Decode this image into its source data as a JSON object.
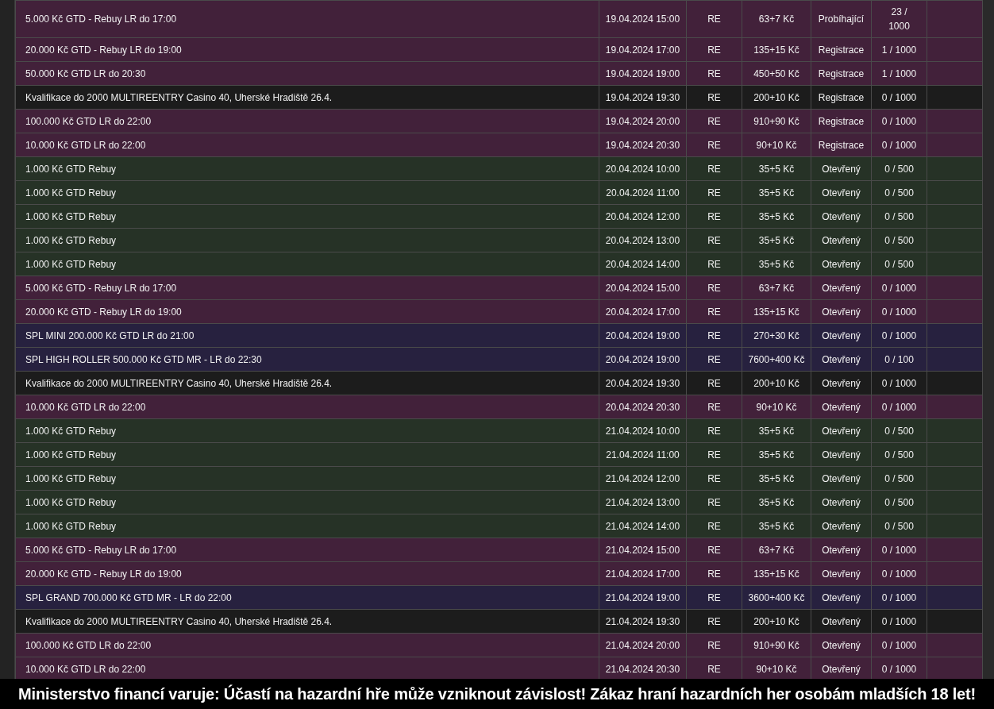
{
  "table": {
    "rows": [
      {
        "name": "5.000 Kč GTD - Rebuy LR do 17:00",
        "start": "19.04.2024 15:00",
        "type": "RE",
        "buyin": "63+7 Kč",
        "status": "Probíhající",
        "players": "23 / 1000",
        "color": "#42213a"
      },
      {
        "name": "20.000 Kč GTD - Rebuy LR do 19:00",
        "start": "19.04.2024 17:00",
        "type": "RE",
        "buyin": "135+15 Kč",
        "status": "Registrace",
        "players": "1 / 1000",
        "color": "#42213a"
      },
      {
        "name": "50.000 Kč GTD LR do 20:30",
        "start": "19.04.2024 19:00",
        "type": "RE",
        "buyin": "450+50 Kč",
        "status": "Registrace",
        "players": "1 / 1000",
        "color": "#42213a"
      },
      {
        "name": "Kvalifikace do 2000 MULTIREENTRY Casino 40, Uherské Hradiště 26.4.",
        "start": "19.04.2024 19:30",
        "type": "RE",
        "buyin": "200+10 Kč",
        "status": "Registrace",
        "players": "0 / 1000",
        "color": "#1c1c1c"
      },
      {
        "name": "100.000 Kč GTD LR do 22:00",
        "start": "19.04.2024 20:00",
        "type": "RE",
        "buyin": "910+90 Kč",
        "status": "Registrace",
        "players": "0 / 1000",
        "color": "#42213a"
      },
      {
        "name": "10.000 Kč GTD LR do 22:00",
        "start": "19.04.2024 20:30",
        "type": "RE",
        "buyin": "90+10 Kč",
        "status": "Registrace",
        "players": "0 / 1000",
        "color": "#42213a"
      },
      {
        "name": "1.000 Kč GTD Rebuy",
        "start": "20.04.2024 10:00",
        "type": "RE",
        "buyin": "35+5 Kč",
        "status": "Otevřený",
        "players": "0 / 500",
        "color": "#263226"
      },
      {
        "name": "1.000 Kč GTD Rebuy",
        "start": "20.04.2024 11:00",
        "type": "RE",
        "buyin": "35+5 Kč",
        "status": "Otevřený",
        "players": "0 / 500",
        "color": "#263226"
      },
      {
        "name": "1.000 Kč GTD Rebuy",
        "start": "20.04.2024 12:00",
        "type": "RE",
        "buyin": "35+5 Kč",
        "status": "Otevřený",
        "players": "0 / 500",
        "color": "#263226"
      },
      {
        "name": "1.000 Kč GTD Rebuy",
        "start": "20.04.2024 13:00",
        "type": "RE",
        "buyin": "35+5 Kč",
        "status": "Otevřený",
        "players": "0 / 500",
        "color": "#263226"
      },
      {
        "name": "1.000 Kč GTD Rebuy",
        "start": "20.04.2024 14:00",
        "type": "RE",
        "buyin": "35+5 Kč",
        "status": "Otevřený",
        "players": "0 / 500",
        "color": "#263226"
      },
      {
        "name": "5.000 Kč GTD - Rebuy LR do 17:00",
        "start": "20.04.2024 15:00",
        "type": "RE",
        "buyin": "63+7 Kč",
        "status": "Otevřený",
        "players": "0 / 1000",
        "color": "#42213a"
      },
      {
        "name": "20.000 Kč GTD - Rebuy LR do 19:00",
        "start": "20.04.2024 17:00",
        "type": "RE",
        "buyin": "135+15 Kč",
        "status": "Otevřený",
        "players": "0 / 1000",
        "color": "#42213a"
      },
      {
        "name": "SPL MINI 200.000 Kč GTD LR do 21:00",
        "start": "20.04.2024 19:00",
        "type": "RE",
        "buyin": "270+30 Kč",
        "status": "Otevřený",
        "players": "0 / 1000",
        "color": "#27213f"
      },
      {
        "name": "SPL HIGH ROLLER 500.000 Kč GTD MR - LR do 22:30",
        "start": "20.04.2024 19:00",
        "type": "RE",
        "buyin": "7600+400 Kč",
        "status": "Otevřený",
        "players": "0 / 100",
        "color": "#27213f"
      },
      {
        "name": "Kvalifikace do 2000 MULTIREENTRY Casino 40, Uherské Hradiště 26.4.",
        "start": "20.04.2024 19:30",
        "type": "RE",
        "buyin": "200+10 Kč",
        "status": "Otevřený",
        "players": "0 / 1000",
        "color": "#1c1c1c"
      },
      {
        "name": "10.000 Kč GTD LR do 22:00",
        "start": "20.04.2024 20:30",
        "type": "RE",
        "buyin": "90+10 Kč",
        "status": "Otevřený",
        "players": "0 / 1000",
        "color": "#42213a"
      },
      {
        "name": "1.000 Kč GTD Rebuy",
        "start": "21.04.2024 10:00",
        "type": "RE",
        "buyin": "35+5 Kč",
        "status": "Otevřený",
        "players": "0 / 500",
        "color": "#263226"
      },
      {
        "name": "1.000 Kč GTD Rebuy",
        "start": "21.04.2024 11:00",
        "type": "RE",
        "buyin": "35+5 Kč",
        "status": "Otevřený",
        "players": "0 / 500",
        "color": "#263226"
      },
      {
        "name": "1.000 Kč GTD Rebuy",
        "start": "21.04.2024 12:00",
        "type": "RE",
        "buyin": "35+5 Kč",
        "status": "Otevřený",
        "players": "0 / 500",
        "color": "#263226"
      },
      {
        "name": "1.000 Kč GTD Rebuy",
        "start": "21.04.2024 13:00",
        "type": "RE",
        "buyin": "35+5 Kč",
        "status": "Otevřený",
        "players": "0 / 500",
        "color": "#263226"
      },
      {
        "name": "1.000 Kč GTD Rebuy",
        "start": "21.04.2024 14:00",
        "type": "RE",
        "buyin": "35+5 Kč",
        "status": "Otevřený",
        "players": "0 / 500",
        "color": "#263226"
      },
      {
        "name": "5.000 Kč GTD - Rebuy LR do 17:00",
        "start": "21.04.2024 15:00",
        "type": "RE",
        "buyin": "63+7 Kč",
        "status": "Otevřený",
        "players": "0 / 1000",
        "color": "#42213a"
      },
      {
        "name": "20.000 Kč GTD - Rebuy LR do 19:00",
        "start": "21.04.2024 17:00",
        "type": "RE",
        "buyin": "135+15 Kč",
        "status": "Otevřený",
        "players": "0 / 1000",
        "color": "#42213a"
      },
      {
        "name": "SPL GRAND 700.000 Kč GTD MR - LR do 22:00",
        "start": "21.04.2024 19:00",
        "type": "RE",
        "buyin": "3600+400 Kč",
        "status": "Otevřený",
        "players": "0 / 1000",
        "color": "#27213f"
      },
      {
        "name": "Kvalifikace do 2000 MULTIREENTRY Casino 40, Uherské Hradiště 26.4.",
        "start": "21.04.2024 19:30",
        "type": "RE",
        "buyin": "200+10 Kč",
        "status": "Otevřený",
        "players": "0 / 1000",
        "color": "#1c1c1c"
      },
      {
        "name": "100.000 Kč GTD LR do 22:00",
        "start": "21.04.2024 20:00",
        "type": "RE",
        "buyin": "910+90 Kč",
        "status": "Otevřený",
        "players": "0 / 1000",
        "color": "#42213a"
      },
      {
        "name": "10.000 Kč GTD LR do 22:00",
        "start": "21.04.2024 20:30",
        "type": "RE",
        "buyin": "90+10 Kč",
        "status": "Otevřený",
        "players": "0 / 1000",
        "color": "#42213a"
      }
    ]
  },
  "warning_banner": {
    "text": "Ministerstvo financí varuje: Účastí na hazardní hře může vzniknout závislost! Zákaz hraní hazardních her osobám mladších 18 let!"
  }
}
